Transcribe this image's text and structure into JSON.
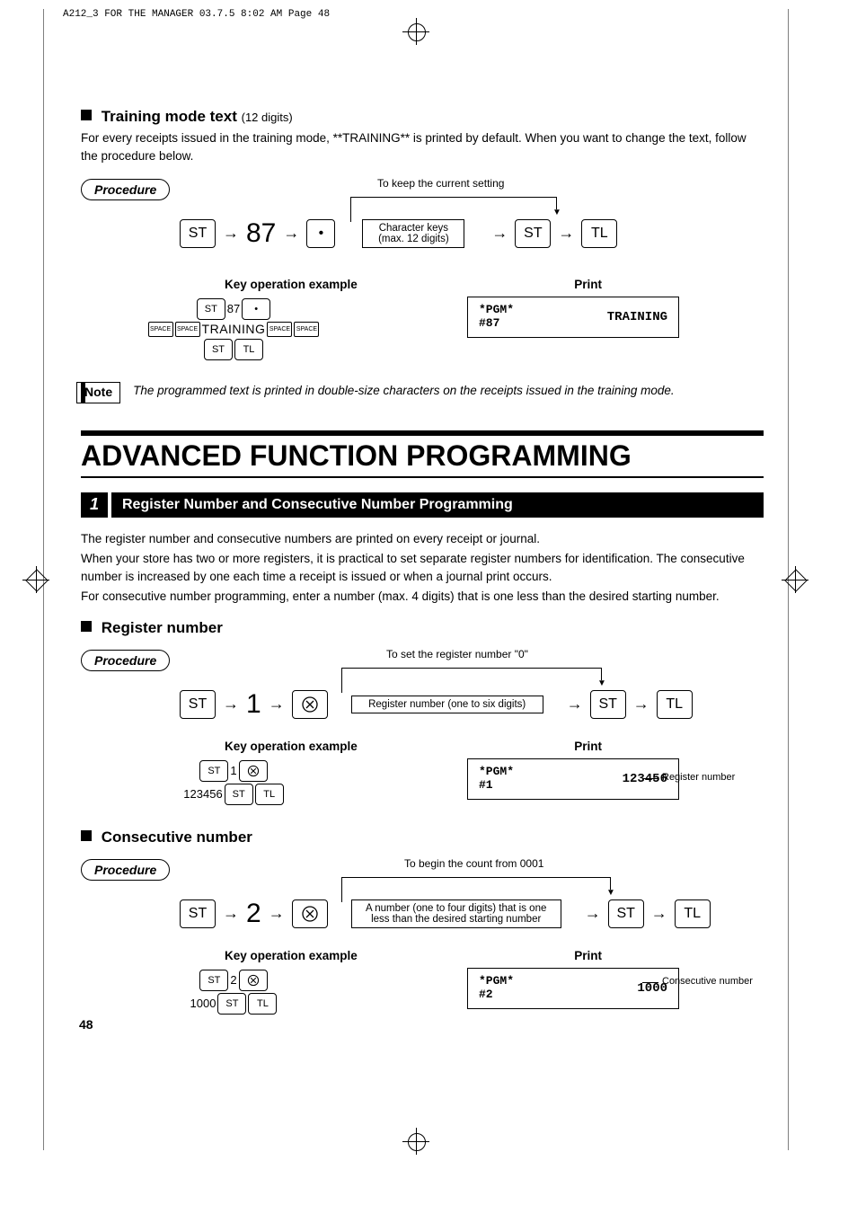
{
  "cropmark": "A212_3 FOR THE MANAGER  03.7.5 8:02 AM  Page 48",
  "sec1": {
    "heading": "Training mode text",
    "digits": "(12 digits)",
    "intro": "For every receipts issued in the training mode, **TRAINING** is printed by default.  When you want to change the text, follow the procedure below.",
    "procedure": "Procedure",
    "branchNote": "To keep the current setting",
    "num": "87",
    "charKeys": "Character keys (max. 12 digits)",
    "koeHdr": "Key operation example",
    "printHdr": "Print",
    "trainingWord": "TRAINING",
    "space": "SPACE",
    "print": {
      "pgm": "*PGM*",
      "line": "#87",
      "val": "TRAINING"
    },
    "noteLabel": "Note",
    "noteText": "The programmed text is printed in double-size characters on the receipts issued in the training mode."
  },
  "title": "ADVANCED FUNCTION PROGRAMMING",
  "chapter": {
    "num": "1",
    "title": "Register Number and Consecutive Number Programming"
  },
  "intro2a": "The register number and consecutive numbers are printed on every receipt or journal.",
  "intro2b": "When your store has two or more registers, it is practical to set separate register numbers for identification.  The consecutive number is increased by one each time a receipt is issued or when a journal print occurs.",
  "intro2c": "For consecutive number programming, enter a number (max. 4 digits) that is one less than the desired starting number.",
  "reg": {
    "heading": "Register number",
    "procedure": "Procedure",
    "branchNote": "To set the register number \"0\"",
    "num": "1",
    "box": "Register number (one to six digits)",
    "koeHdr": "Key operation example",
    "printHdr": "Print",
    "koeVal": "123456",
    "print": {
      "pgm": "*PGM*",
      "line": "#1",
      "val": "123456",
      "ann": "Register number"
    }
  },
  "cons": {
    "heading": "Consecutive number",
    "procedure": "Procedure",
    "branchNote": "To begin the count from 0001",
    "num": "2",
    "box": "A number (one to four digits) that is one less than the desired starting number",
    "koeHdr": "Key operation example",
    "printHdr": "Print",
    "koeVal": "1000",
    "print": {
      "pgm": "*PGM*",
      "line": "#2",
      "val": "1000",
      "ann": "Consecutive number"
    }
  },
  "keys": {
    "st": "ST",
    "tl": "TL",
    "dot": "•"
  },
  "pagenum": "48"
}
